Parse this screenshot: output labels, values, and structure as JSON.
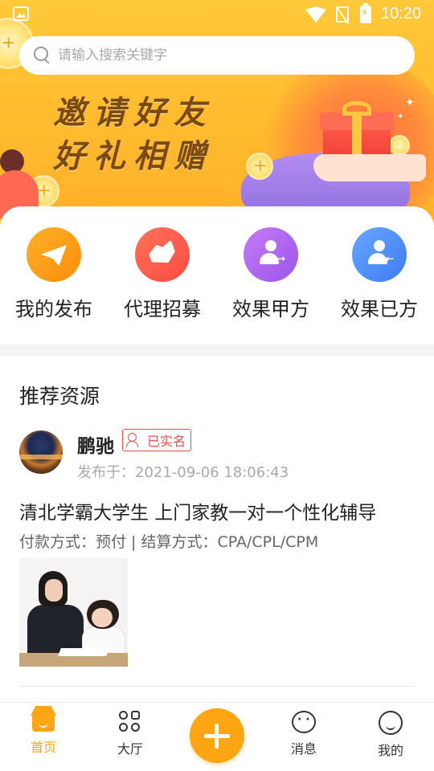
{
  "status_bar": {
    "time": "10:20"
  },
  "search": {
    "placeholder": "请输入搜索关键字"
  },
  "banner": {
    "line1": "邀请好友",
    "line2": "好礼相赠"
  },
  "quick_menu": [
    {
      "label": "我的发布",
      "icon": "paper-plane-icon",
      "color": "#ffa41a"
    },
    {
      "label": "代理招募",
      "icon": "handshake-icon",
      "color": "#ff5a4a"
    },
    {
      "label": "效果甲方",
      "icon": "user-forward-icon",
      "color": "#a561ee"
    },
    {
      "label": "效果已方",
      "icon": "user-back-icon",
      "color": "#4d88f6"
    }
  ],
  "recommend": {
    "section_title": "推荐资源",
    "author": "鹏驰",
    "verified_label": "已实名",
    "published": "发布于：2021-09-06 18:06:43",
    "title": "清北学霸大学生 上门家教一对一个性化辅导",
    "payment": "付款方式：预付 | 结算方式：CPA/CPL/CPM"
  },
  "bottom_nav": {
    "home": "首页",
    "hall": "大厅",
    "messages": "消息",
    "me": "我的",
    "accent": "#ffa412"
  }
}
